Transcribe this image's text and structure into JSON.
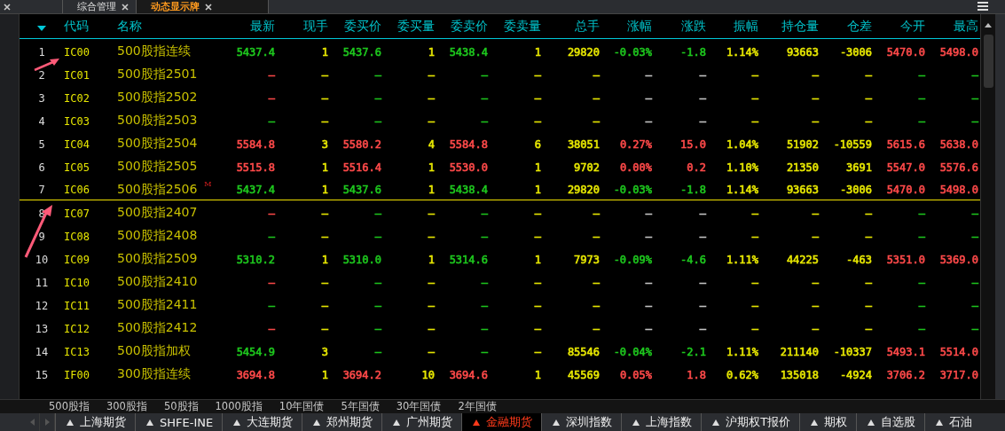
{
  "tabs": [
    {
      "label": "综合管理",
      "selected": false
    },
    {
      "label": "动态显示牌",
      "selected": true
    }
  ],
  "table": {
    "columns": [
      "",
      "代码",
      "名称",
      "最新",
      "现手",
      "委买价",
      "委买量",
      "委卖价",
      "委卖量",
      "总手",
      "涨幅",
      "涨跌",
      "振幅",
      "持仓量",
      "仓差",
      "今开",
      "最高"
    ],
    "rows": [
      {
        "divider_after": false,
        "cells": [
          {
            "text": "1"
          },
          {
            "text": "IC00"
          },
          {
            "text": "500股指连续"
          },
          {
            "text": "5437.4",
            "color": "#1ec81e"
          },
          {
            "text": "1",
            "color": "#e8e800"
          },
          {
            "text": "5437.6",
            "color": "#1ec81e"
          },
          {
            "text": "1",
            "color": "#e8e800"
          },
          {
            "text": "5438.4",
            "color": "#1ec81e"
          },
          {
            "text": "1",
            "color": "#e8e800"
          },
          {
            "text": "29820",
            "color": "#e8e800"
          },
          {
            "text": "-0.03%",
            "color": "#1ec81e"
          },
          {
            "text": "-1.8",
            "color": "#1ec81e"
          },
          {
            "text": "1.14%",
            "color": "#e8e800"
          },
          {
            "text": "93663",
            "color": "#e8e800"
          },
          {
            "text": "-3006",
            "color": "#e8e800"
          },
          {
            "text": "5470.0",
            "color": "#ff4a4a"
          },
          {
            "text": "5498.0",
            "color": "#ff4a4a"
          }
        ]
      },
      {
        "divider_after": false,
        "cells": [
          {
            "text": "2"
          },
          {
            "text": "IC01"
          },
          {
            "text": "500股指2501"
          },
          {
            "text": "—",
            "color": "#ff4a4a"
          },
          {
            "text": "—",
            "color": "#e8e800"
          },
          {
            "text": "—",
            "color": "#1ec81e"
          },
          {
            "text": "—",
            "color": "#e8e800"
          },
          {
            "text": "—",
            "color": "#1ec81e"
          },
          {
            "text": "—",
            "color": "#e8e800"
          },
          {
            "text": "—",
            "color": "#e8e800"
          },
          {
            "text": "—",
            "color": "#c8c8c8"
          },
          {
            "text": "—",
            "color": "#c8c8c8"
          },
          {
            "text": "—",
            "color": "#e8e800"
          },
          {
            "text": "—",
            "color": "#e8e800"
          },
          {
            "text": "—",
            "color": "#e8e800"
          },
          {
            "text": "—",
            "color": "#1ec81e"
          },
          {
            "text": "—",
            "color": "#1ec81e"
          }
        ]
      },
      {
        "divider_after": false,
        "cells": [
          {
            "text": "3"
          },
          {
            "text": "IC02"
          },
          {
            "text": "500股指2502"
          },
          {
            "text": "—",
            "color": "#ff4a4a"
          },
          {
            "text": "—",
            "color": "#e8e800"
          },
          {
            "text": "—",
            "color": "#1ec81e"
          },
          {
            "text": "—",
            "color": "#e8e800"
          },
          {
            "text": "—",
            "color": "#1ec81e"
          },
          {
            "text": "—",
            "color": "#e8e800"
          },
          {
            "text": "—",
            "color": "#e8e800"
          },
          {
            "text": "—",
            "color": "#c8c8c8"
          },
          {
            "text": "—",
            "color": "#c8c8c8"
          },
          {
            "text": "—",
            "color": "#e8e800"
          },
          {
            "text": "—",
            "color": "#e8e800"
          },
          {
            "text": "—",
            "color": "#e8e800"
          },
          {
            "text": "—",
            "color": "#1ec81e"
          },
          {
            "text": "—",
            "color": "#1ec81e"
          }
        ]
      },
      {
        "divider_after": false,
        "cells": [
          {
            "text": "4"
          },
          {
            "text": "IC03"
          },
          {
            "text": "500股指2503"
          },
          {
            "text": "—",
            "color": "#1ec81e"
          },
          {
            "text": "—",
            "color": "#e8e800"
          },
          {
            "text": "—",
            "color": "#1ec81e"
          },
          {
            "text": "—",
            "color": "#e8e800"
          },
          {
            "text": "—",
            "color": "#1ec81e"
          },
          {
            "text": "—",
            "color": "#e8e800"
          },
          {
            "text": "—",
            "color": "#e8e800"
          },
          {
            "text": "—",
            "color": "#c8c8c8"
          },
          {
            "text": "—",
            "color": "#c8c8c8"
          },
          {
            "text": "—",
            "color": "#e8e800"
          },
          {
            "text": "—",
            "color": "#e8e800"
          },
          {
            "text": "—",
            "color": "#e8e800"
          },
          {
            "text": "—",
            "color": "#1ec81e"
          },
          {
            "text": "—",
            "color": "#1ec81e"
          }
        ]
      },
      {
        "divider_after": false,
        "cells": [
          {
            "text": "5"
          },
          {
            "text": "IC04"
          },
          {
            "text": "500股指2504"
          },
          {
            "text": "5584.8",
            "color": "#ff4a4a"
          },
          {
            "text": "3",
            "color": "#e8e800"
          },
          {
            "text": "5580.2",
            "color": "#ff4a4a"
          },
          {
            "text": "4",
            "color": "#e8e800"
          },
          {
            "text": "5584.8",
            "color": "#ff4a4a"
          },
          {
            "text": "6",
            "color": "#e8e800"
          },
          {
            "text": "38051",
            "color": "#e8e800"
          },
          {
            "text": "0.27%",
            "color": "#ff4a4a"
          },
          {
            "text": "15.0",
            "color": "#ff4a4a"
          },
          {
            "text": "1.04%",
            "color": "#e8e800"
          },
          {
            "text": "51902",
            "color": "#e8e800"
          },
          {
            "text": "-10559",
            "color": "#e8e800"
          },
          {
            "text": "5615.6",
            "color": "#ff4a4a"
          },
          {
            "text": "5638.0",
            "color": "#ff4a4a"
          }
        ]
      },
      {
        "divider_after": false,
        "cells": [
          {
            "text": "6"
          },
          {
            "text": "IC05"
          },
          {
            "text": "500股指2505"
          },
          {
            "text": "5515.8",
            "color": "#ff4a4a"
          },
          {
            "text": "1",
            "color": "#e8e800"
          },
          {
            "text": "5516.4",
            "color": "#ff4a4a"
          },
          {
            "text": "1",
            "color": "#e8e800"
          },
          {
            "text": "5530.0",
            "color": "#ff4a4a"
          },
          {
            "text": "1",
            "color": "#e8e800"
          },
          {
            "text": "9702",
            "color": "#e8e800"
          },
          {
            "text": "0.00%",
            "color": "#ff4a4a"
          },
          {
            "text": "0.2",
            "color": "#ff4a4a"
          },
          {
            "text": "1.10%",
            "color": "#e8e800"
          },
          {
            "text": "21350",
            "color": "#e8e800"
          },
          {
            "text": "3691",
            "color": "#e8e800"
          },
          {
            "text": "5547.0",
            "color": "#ff4a4a"
          },
          {
            "text": "5576.6",
            "color": "#ff4a4a"
          }
        ]
      },
      {
        "divider_after": true,
        "cells": [
          {
            "text": "7"
          },
          {
            "text": "IC06"
          },
          {
            "text": "500股指2506"
          },
          {
            "text": "5437.4",
            "color": "#1ec81e"
          },
          {
            "text": "1",
            "color": "#e8e800"
          },
          {
            "text": "5437.6",
            "color": "#1ec81e"
          },
          {
            "text": "1",
            "color": "#e8e800"
          },
          {
            "text": "5438.4",
            "color": "#1ec81e"
          },
          {
            "text": "1",
            "color": "#e8e800"
          },
          {
            "text": "29820",
            "color": "#e8e800"
          },
          {
            "text": "-0.03%",
            "color": "#1ec81e"
          },
          {
            "text": "-1.8",
            "color": "#1ec81e"
          },
          {
            "text": "1.14%",
            "color": "#e8e800"
          },
          {
            "text": "93663",
            "color": "#e8e800"
          },
          {
            "text": "-3006",
            "color": "#e8e800"
          },
          {
            "text": "5470.0",
            "color": "#ff4a4a"
          },
          {
            "text": "5498.0",
            "color": "#ff4a4a"
          }
        ],
        "flag": "M"
      },
      {
        "divider_after": false,
        "cells": [
          {
            "text": "8"
          },
          {
            "text": "IC07"
          },
          {
            "text": "500股指2407"
          },
          {
            "text": "—",
            "color": "#ff4a4a"
          },
          {
            "text": "—",
            "color": "#e8e800"
          },
          {
            "text": "—",
            "color": "#1ec81e"
          },
          {
            "text": "—",
            "color": "#e8e800"
          },
          {
            "text": "—",
            "color": "#1ec81e"
          },
          {
            "text": "—",
            "color": "#e8e800"
          },
          {
            "text": "—",
            "color": "#e8e800"
          },
          {
            "text": "—",
            "color": "#c8c8c8"
          },
          {
            "text": "—",
            "color": "#c8c8c8"
          },
          {
            "text": "—",
            "color": "#e8e800"
          },
          {
            "text": "—",
            "color": "#e8e800"
          },
          {
            "text": "—",
            "color": "#e8e800"
          },
          {
            "text": "—",
            "color": "#1ec81e"
          },
          {
            "text": "—",
            "color": "#1ec81e"
          }
        ]
      },
      {
        "divider_after": false,
        "cells": [
          {
            "text": "9"
          },
          {
            "text": "IC08"
          },
          {
            "text": "500股指2408"
          },
          {
            "text": "—",
            "color": "#1ec81e"
          },
          {
            "text": "—",
            "color": "#e8e800"
          },
          {
            "text": "—",
            "color": "#1ec81e"
          },
          {
            "text": "—",
            "color": "#e8e800"
          },
          {
            "text": "—",
            "color": "#1ec81e"
          },
          {
            "text": "—",
            "color": "#e8e800"
          },
          {
            "text": "—",
            "color": "#e8e800"
          },
          {
            "text": "—",
            "color": "#c8c8c8"
          },
          {
            "text": "—",
            "color": "#c8c8c8"
          },
          {
            "text": "—",
            "color": "#e8e800"
          },
          {
            "text": "—",
            "color": "#e8e800"
          },
          {
            "text": "—",
            "color": "#e8e800"
          },
          {
            "text": "—",
            "color": "#1ec81e"
          },
          {
            "text": "—",
            "color": "#1ec81e"
          }
        ]
      },
      {
        "divider_after": false,
        "cells": [
          {
            "text": "10"
          },
          {
            "text": "IC09"
          },
          {
            "text": "500股指2509"
          },
          {
            "text": "5310.2",
            "color": "#1ec81e"
          },
          {
            "text": "1",
            "color": "#e8e800"
          },
          {
            "text": "5310.0",
            "color": "#1ec81e"
          },
          {
            "text": "1",
            "color": "#e8e800"
          },
          {
            "text": "5314.6",
            "color": "#1ec81e"
          },
          {
            "text": "1",
            "color": "#e8e800"
          },
          {
            "text": "7973",
            "color": "#e8e800"
          },
          {
            "text": "-0.09%",
            "color": "#1ec81e"
          },
          {
            "text": "-4.6",
            "color": "#1ec81e"
          },
          {
            "text": "1.11%",
            "color": "#e8e800"
          },
          {
            "text": "44225",
            "color": "#e8e800"
          },
          {
            "text": "-463",
            "color": "#e8e800"
          },
          {
            "text": "5351.0",
            "color": "#ff4a4a"
          },
          {
            "text": "5369.0",
            "color": "#ff4a4a"
          }
        ]
      },
      {
        "divider_after": false,
        "cells": [
          {
            "text": "11"
          },
          {
            "text": "IC10"
          },
          {
            "text": "500股指2410"
          },
          {
            "text": "—",
            "color": "#ff4a4a"
          },
          {
            "text": "—",
            "color": "#e8e800"
          },
          {
            "text": "—",
            "color": "#1ec81e"
          },
          {
            "text": "—",
            "color": "#e8e800"
          },
          {
            "text": "—",
            "color": "#1ec81e"
          },
          {
            "text": "—",
            "color": "#e8e800"
          },
          {
            "text": "—",
            "color": "#e8e800"
          },
          {
            "text": "—",
            "color": "#c8c8c8"
          },
          {
            "text": "—",
            "color": "#c8c8c8"
          },
          {
            "text": "—",
            "color": "#e8e800"
          },
          {
            "text": "—",
            "color": "#e8e800"
          },
          {
            "text": "—",
            "color": "#e8e800"
          },
          {
            "text": "—",
            "color": "#1ec81e"
          },
          {
            "text": "—",
            "color": "#1ec81e"
          }
        ]
      },
      {
        "divider_after": false,
        "cells": [
          {
            "text": "12"
          },
          {
            "text": "IC11"
          },
          {
            "text": "500股指2411"
          },
          {
            "text": "—",
            "color": "#1ec81e"
          },
          {
            "text": "—",
            "color": "#e8e800"
          },
          {
            "text": "—",
            "color": "#1ec81e"
          },
          {
            "text": "—",
            "color": "#e8e800"
          },
          {
            "text": "—",
            "color": "#1ec81e"
          },
          {
            "text": "—",
            "color": "#e8e800"
          },
          {
            "text": "—",
            "color": "#e8e800"
          },
          {
            "text": "—",
            "color": "#c8c8c8"
          },
          {
            "text": "—",
            "color": "#c8c8c8"
          },
          {
            "text": "—",
            "color": "#e8e800"
          },
          {
            "text": "—",
            "color": "#e8e800"
          },
          {
            "text": "—",
            "color": "#e8e800"
          },
          {
            "text": "—",
            "color": "#1ec81e"
          },
          {
            "text": "—",
            "color": "#1ec81e"
          }
        ]
      },
      {
        "divider_after": false,
        "cells": [
          {
            "text": "13"
          },
          {
            "text": "IC12"
          },
          {
            "text": "500股指2412"
          },
          {
            "text": "—",
            "color": "#ff4a4a"
          },
          {
            "text": "—",
            "color": "#e8e800"
          },
          {
            "text": "—",
            "color": "#1ec81e"
          },
          {
            "text": "—",
            "color": "#e8e800"
          },
          {
            "text": "—",
            "color": "#1ec81e"
          },
          {
            "text": "—",
            "color": "#e8e800"
          },
          {
            "text": "—",
            "color": "#e8e800"
          },
          {
            "text": "—",
            "color": "#c8c8c8"
          },
          {
            "text": "—",
            "color": "#c8c8c8"
          },
          {
            "text": "—",
            "color": "#e8e800"
          },
          {
            "text": "—",
            "color": "#e8e800"
          },
          {
            "text": "—",
            "color": "#e8e800"
          },
          {
            "text": "—",
            "color": "#1ec81e"
          },
          {
            "text": "—",
            "color": "#1ec81e"
          }
        ]
      },
      {
        "divider_after": false,
        "cells": [
          {
            "text": "14"
          },
          {
            "text": "IC13"
          },
          {
            "text": "500股指加权"
          },
          {
            "text": "5454.9",
            "color": "#1ec81e"
          },
          {
            "text": "3",
            "color": "#e8e800"
          },
          {
            "text": "—",
            "color": "#1ec81e"
          },
          {
            "text": "—",
            "color": "#e8e800"
          },
          {
            "text": "—",
            "color": "#1ec81e"
          },
          {
            "text": "—",
            "color": "#e8e800"
          },
          {
            "text": "85546",
            "color": "#e8e800"
          },
          {
            "text": "-0.04%",
            "color": "#1ec81e"
          },
          {
            "text": "-2.1",
            "color": "#1ec81e"
          },
          {
            "text": "1.11%",
            "color": "#e8e800"
          },
          {
            "text": "211140",
            "color": "#e8e800"
          },
          {
            "text": "-10337",
            "color": "#e8e800"
          },
          {
            "text": "5493.1",
            "color": "#ff4a4a"
          },
          {
            "text": "5514.0",
            "color": "#ff4a4a"
          }
        ]
      },
      {
        "divider_after": false,
        "cells": [
          {
            "text": "15"
          },
          {
            "text": "IF00"
          },
          {
            "text": "300股指连续"
          },
          {
            "text": "3694.8",
            "color": "#ff4a4a"
          },
          {
            "text": "1",
            "color": "#e8e800"
          },
          {
            "text": "3694.2",
            "color": "#ff4a4a"
          },
          {
            "text": "10",
            "color": "#e8e800"
          },
          {
            "text": "3694.6",
            "color": "#ff4a4a"
          },
          {
            "text": "1",
            "color": "#e8e800"
          },
          {
            "text": "45569",
            "color": "#e8e800"
          },
          {
            "text": "0.05%",
            "color": "#ff4a4a"
          },
          {
            "text": "1.8",
            "color": "#ff4a4a"
          },
          {
            "text": "0.62%",
            "color": "#e8e800"
          },
          {
            "text": "135018",
            "color": "#e8e800"
          },
          {
            "text": "-4924",
            "color": "#e8e800"
          },
          {
            "text": "3706.2",
            "color": "#ff4a4a"
          },
          {
            "text": "3717.0",
            "color": "#ff4a4a"
          }
        ]
      }
    ]
  },
  "index_tabs": [
    "500股指",
    "300股指",
    "50股指",
    "1000股指",
    "10年国债",
    "5年国债",
    "30年国债",
    "2年国债"
  ],
  "market_tabs": [
    {
      "label": "上海期货",
      "selected": false
    },
    {
      "label": "SHFE-INE",
      "selected": false
    },
    {
      "label": "大连期货",
      "selected": false
    },
    {
      "label": "郑州期货",
      "selected": false
    },
    {
      "label": "广州期货",
      "selected": false
    },
    {
      "label": "金融期货",
      "selected": true
    },
    {
      "label": "深圳指数",
      "selected": false
    },
    {
      "label": "上海指数",
      "selected": false
    },
    {
      "label": "沪期权T报价",
      "selected": false
    },
    {
      "label": "期权",
      "selected": false
    },
    {
      "label": "自选股",
      "selected": false
    },
    {
      "label": "石油",
      "selected": false
    }
  ]
}
